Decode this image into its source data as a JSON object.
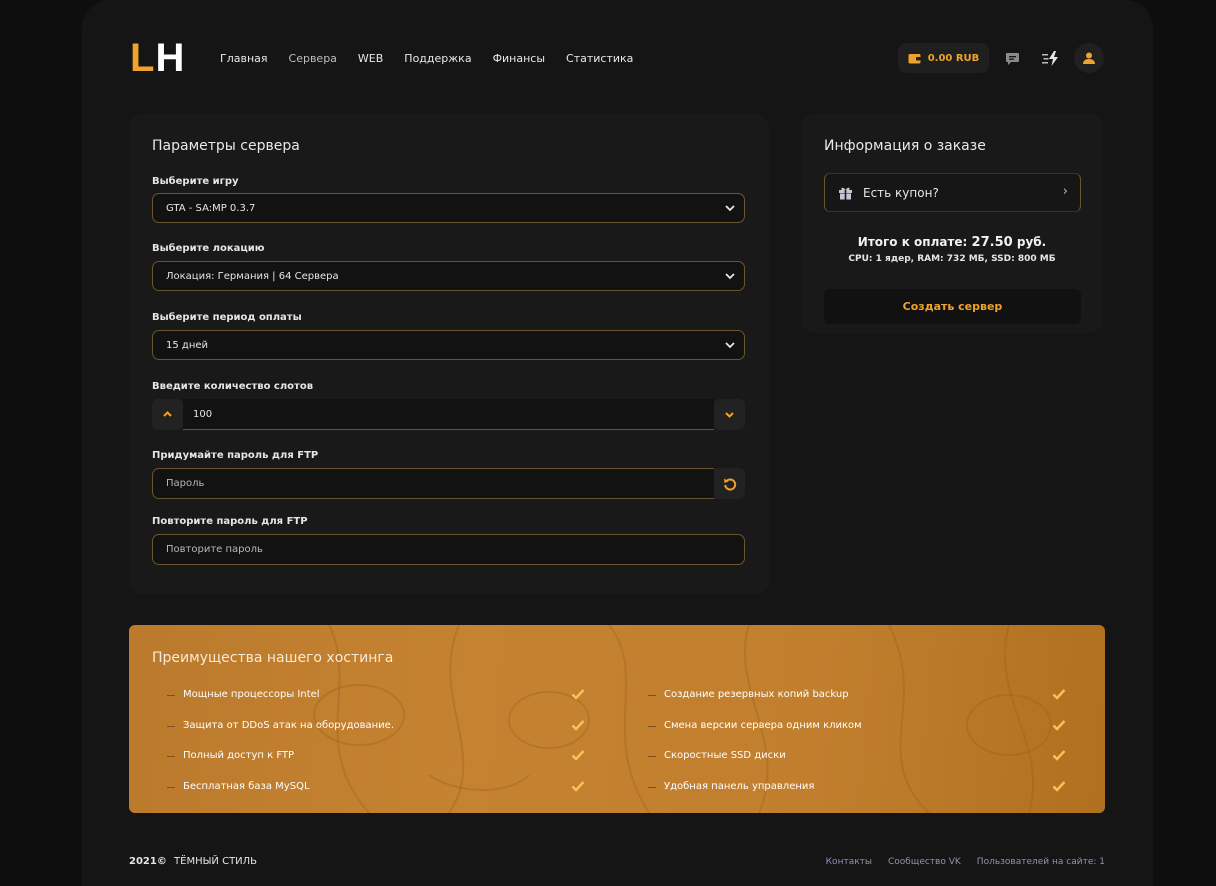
{
  "header": {
    "logo_left": "L",
    "logo_right": "H",
    "nav": [
      "Главная",
      "Сервера",
      "WEB",
      "Поддержка",
      "Финансы",
      "Статистика"
    ],
    "balance": "0.00 RUB"
  },
  "params": {
    "title": "Параметры сервера",
    "game_label": "Выберите игру",
    "game_value": "GTA - SA:MP 0.3.7",
    "location_label": "Выберите локацию",
    "location_value": "Локация: Германия | 64 Сервера",
    "period_label": "Выберите период оплаты",
    "period_value": "15 дней",
    "slots_label": "Введите количество слотов",
    "slots_value": "100",
    "ftp_label": "Придумайте пароль для FTP",
    "ftp_placeholder": "Пароль",
    "ftp_repeat_label": "Повторите пароль для FTP",
    "ftp_repeat_placeholder": "Повторите пароль"
  },
  "order": {
    "title": "Информация о заказе",
    "coupon": "Есть купон?",
    "total_label": "Итого к оплате:",
    "total_amount": "27.50",
    "total_currency": "руб.",
    "specs": "CPU: 1 ядер, RAM: 732 МБ, SSD: 800 МБ",
    "create_button": "Создать сервер"
  },
  "advantages": {
    "title": "Преимущества нашего хостинга",
    "left": [
      "Мощные процессоры Intel",
      "Защита от DDoS атак на оборудование.",
      "Полный доступ к FTP",
      "Бесплатная база MySQL"
    ],
    "right": [
      "Создание резервных копий backup",
      "Смена версии сервера одним кликом",
      "Скоростные SSD диски",
      "Удобная панель управления"
    ]
  },
  "footer": {
    "year": "2021©",
    "style": "ТЁМНЫЙ СТИЛЬ",
    "links": [
      "Контакты",
      "Сообщество VK",
      "Пользователей на сайте: 1"
    ]
  },
  "colors": {
    "accent": "#f0a32a",
    "page_bg": "#0e0e0e",
    "card_bg": "#191919",
    "banner": "#c58331"
  }
}
